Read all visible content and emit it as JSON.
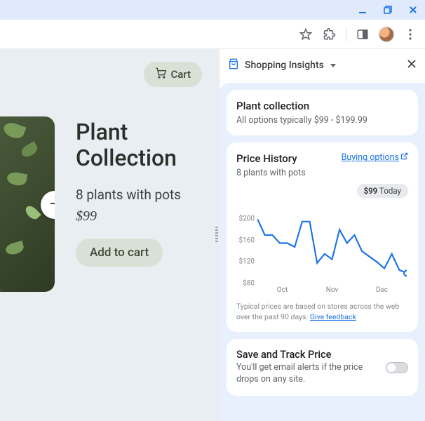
{
  "window": {
    "minimize": "–",
    "restore": "⧉",
    "close": "×"
  },
  "product": {
    "cart_label": "Cart",
    "title_line1": "Plant",
    "title_line2": "Collection",
    "subtitle": "8 plants with pots",
    "price": "$99",
    "add_label": "Add to cart"
  },
  "panel": {
    "title": "Shopping Insights",
    "summary": {
      "title": "Plant collection",
      "sub": "All options typically $99 - $199.99"
    },
    "price_history": {
      "title": "Price History",
      "sub": "8 plants with pots",
      "buying_options": "Buying options",
      "today_price": "$99",
      "today_label": "Today",
      "disclaimer": "Typical prices are based on stores across the web over the past 90 days.",
      "feedback": "Give feedback"
    },
    "track": {
      "title": "Save and Track Price",
      "sub": "You'll get email alerts if the price drops on any site."
    }
  },
  "chart_data": {
    "type": "line",
    "y_ticks": [
      200,
      160,
      120,
      80
    ],
    "x_ticks": [
      "Oct",
      "Nov",
      "Dec"
    ],
    "ylim": [
      80,
      200
    ],
    "today_marker": true,
    "series": [
      {
        "name": "price",
        "values": [
          200,
          170,
          170,
          155,
          155,
          148,
          195,
          195,
          118,
          135,
          125,
          180,
          155,
          170,
          140,
          130,
          120,
          108,
          135,
          105,
          99
        ],
        "color": "#1a73e8"
      }
    ]
  }
}
